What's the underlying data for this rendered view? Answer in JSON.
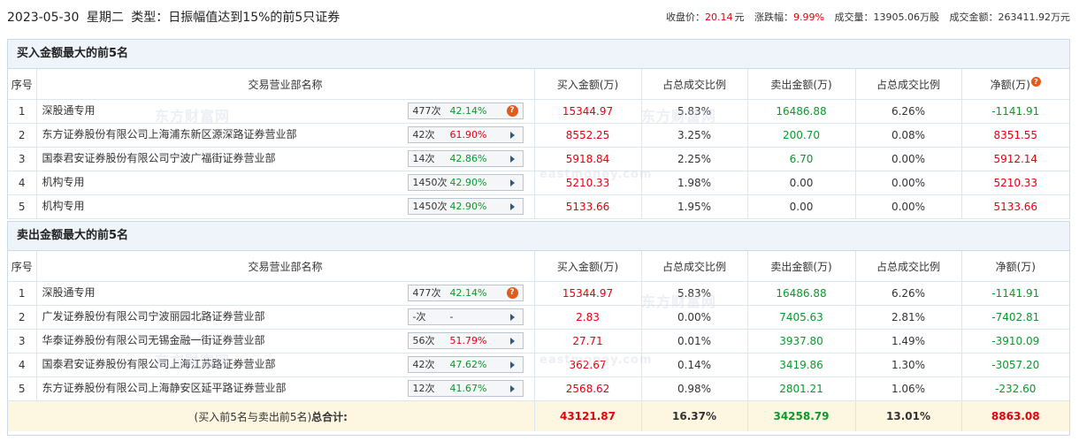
{
  "header": {
    "date": "2023-05-30",
    "weekday": "星期二",
    "type_label": "类型：",
    "type_value": "日振幅值达到15%的前5只证券",
    "close_label": "收盘价：",
    "close_value": "20.14",
    "close_unit": "元",
    "change_label": "涨跌幅：",
    "change_value": "9.99%",
    "volume_label": "成交量：",
    "volume_value": "13905.06万股",
    "amount_label": "成交金额：",
    "amount_value": "263411.92万元"
  },
  "columns": [
    "序号",
    "交易营业部名称",
    "买入金额(万)",
    "占总成交比例",
    "卖出金额(万)",
    "占总成交比例",
    "净额(万)"
  ],
  "buy": {
    "title": "买入金额最大的前5名",
    "rows": [
      {
        "no": "1",
        "name": "深股通专用",
        "cnt": "477次",
        "pct": "42.14%",
        "pct_color": "green",
        "icon": "q",
        "buy": "15344.97",
        "buy_ratio": "5.83%",
        "sell": "16486.88",
        "sell_ratio": "6.26%",
        "net": "-1141.91",
        "net_color": "green"
      },
      {
        "no": "2",
        "name": "东方证券股份有限公司上海浦东新区源深路证券营业部",
        "cnt": "42次",
        "pct": "61.90%",
        "pct_color": "red",
        "icon": "arrow",
        "buy": "8552.25",
        "buy_ratio": "3.25%",
        "sell": "200.70",
        "sell_ratio": "0.08%",
        "net": "8351.55",
        "net_color": "red"
      },
      {
        "no": "3",
        "name": "国泰君安证券股份有限公司宁波广福街证券营业部",
        "cnt": "14次",
        "pct": "42.86%",
        "pct_color": "green",
        "icon": "arrow",
        "buy": "5918.84",
        "buy_ratio": "2.25%",
        "sell": "6.70",
        "sell_ratio": "0.00%",
        "net": "5912.14",
        "net_color": "red"
      },
      {
        "no": "4",
        "name": "机构专用",
        "cnt": "1450次",
        "pct": "42.90%",
        "pct_color": "green",
        "icon": "arrow",
        "buy": "5210.33",
        "buy_ratio": "1.98%",
        "sell": "0.00",
        "sell_ratio": "0.00%",
        "net": "5210.33",
        "net_color": "red"
      },
      {
        "no": "5",
        "name": "机构专用",
        "cnt": "1450次",
        "pct": "42.90%",
        "pct_color": "green",
        "icon": "arrow",
        "buy": "5133.66",
        "buy_ratio": "1.95%",
        "sell": "0.00",
        "sell_ratio": "0.00%",
        "net": "5133.66",
        "net_color": "red"
      }
    ]
  },
  "sell": {
    "title": "卖出金额最大的前5名",
    "rows": [
      {
        "no": "1",
        "name": "深股通专用",
        "cnt": "477次",
        "pct": "42.14%",
        "pct_color": "green",
        "icon": "q",
        "buy": "15344.97",
        "buy_ratio": "5.83%",
        "sell": "16486.88",
        "sell_ratio": "6.26%",
        "net": "-1141.91",
        "net_color": "green"
      },
      {
        "no": "2",
        "name": "广发证券股份有限公司宁波丽园北路证券营业部",
        "cnt": "-次",
        "pct": "-",
        "pct_color": "dark",
        "icon": "arrow",
        "buy": "2.83",
        "buy_ratio": "0.00%",
        "sell": "7405.63",
        "sell_ratio": "2.81%",
        "net": "-7402.81",
        "net_color": "green"
      },
      {
        "no": "3",
        "name": "华泰证券股份有限公司无锡金融一街证券营业部",
        "cnt": "56次",
        "pct": "51.79%",
        "pct_color": "red",
        "icon": "arrow",
        "buy": "27.71",
        "buy_ratio": "0.01%",
        "sell": "3937.80",
        "sell_ratio": "1.49%",
        "net": "-3910.09",
        "net_color": "green"
      },
      {
        "no": "4",
        "name": "国泰君安证券股份有限公司上海江苏路证券营业部",
        "cnt": "42次",
        "pct": "47.62%",
        "pct_color": "green",
        "icon": "arrow",
        "buy": "362.67",
        "buy_ratio": "0.14%",
        "sell": "3419.86",
        "sell_ratio": "1.30%",
        "net": "-3057.20",
        "net_color": "green"
      },
      {
        "no": "5",
        "name": "东方证券股份有限公司上海静安区延平路证券营业部",
        "cnt": "12次",
        "pct": "41.67%",
        "pct_color": "green",
        "icon": "arrow",
        "buy": "2568.62",
        "buy_ratio": "0.98%",
        "sell": "2801.21",
        "sell_ratio": "1.06%",
        "net": "-232.60",
        "net_color": "green"
      }
    ],
    "total": {
      "label_prefix": "(买入前5名与卖出前5名)",
      "label_bold": "总合计:",
      "buy": "43121.87",
      "buy_ratio": "16.37%",
      "sell": "34258.79",
      "sell_ratio": "13.01%",
      "net": "8863.08"
    }
  },
  "watermark": {
    "cn": "东方财富网",
    "en": "eastmoney.com"
  },
  "colors": {
    "red": "#e4000c",
    "green": "#0a9a2a",
    "header_bg": "#eef4fa",
    "total_bg": "#fdf7e1",
    "border": "#c9dbe9",
    "q_icon": "#e35b1c"
  }
}
